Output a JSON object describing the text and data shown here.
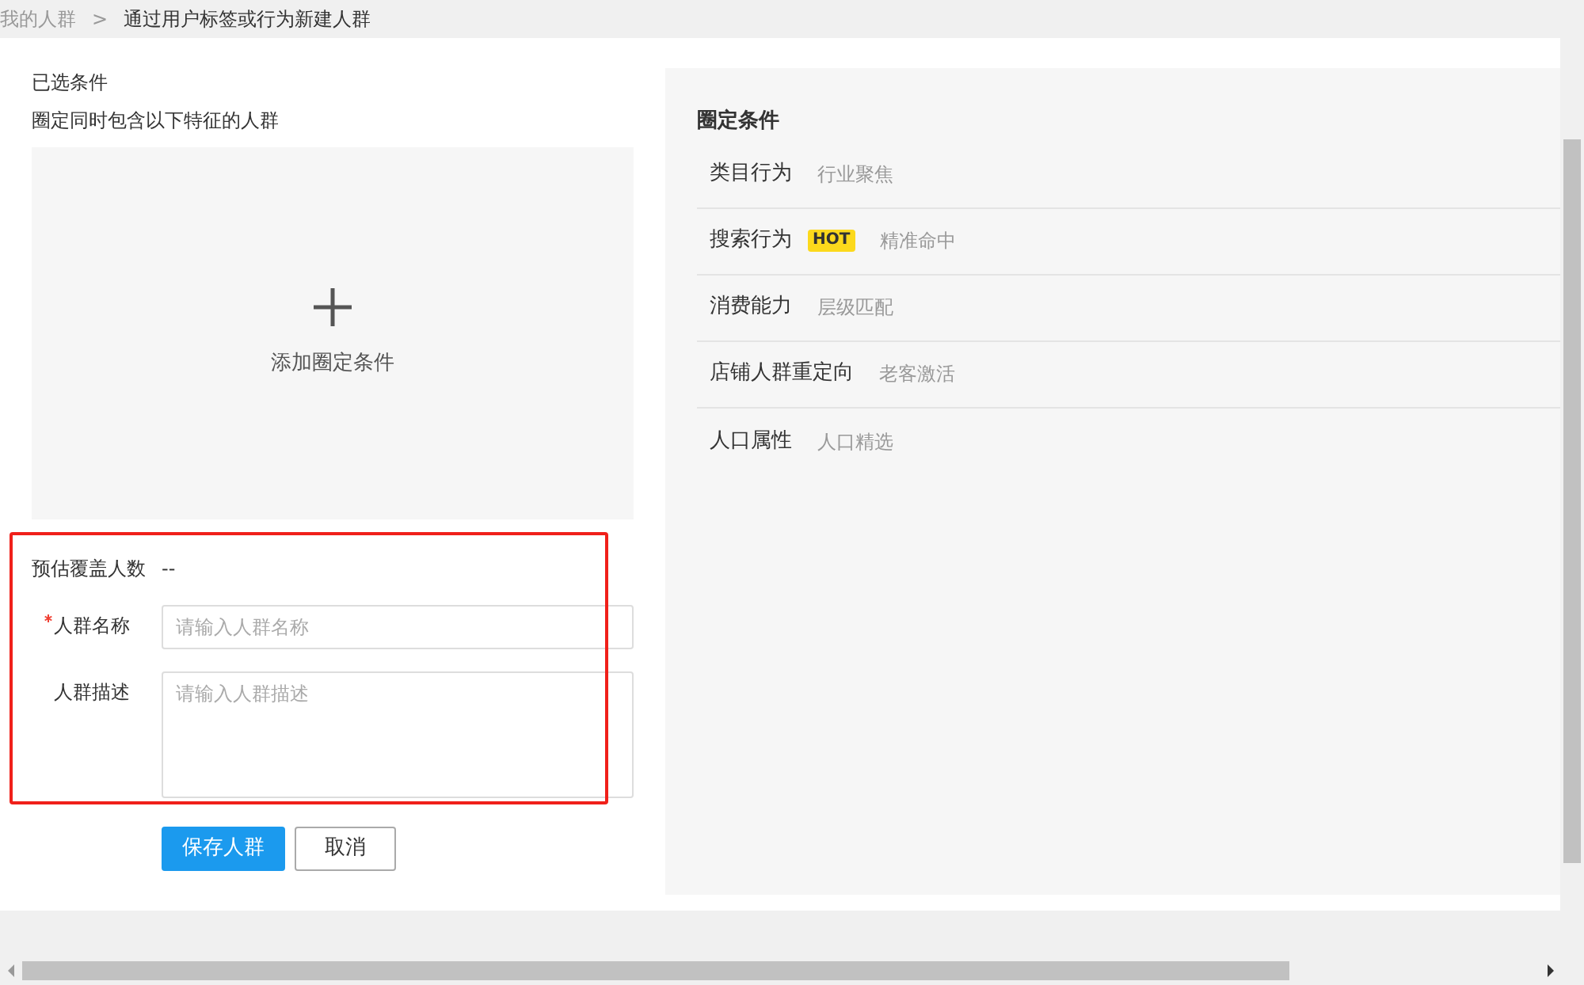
{
  "breadcrumb": {
    "items": [
      "我的人群",
      "通过用户标签或行为新建人群"
    ],
    "separator": ">"
  },
  "selected_conditions": {
    "title": "已选条件",
    "subtitle": "圈定同时包含以下特征的人群",
    "add_label": "添加圈定条件"
  },
  "form": {
    "estimate": {
      "label": "预估覆盖人数",
      "value": "--"
    },
    "fields": [
      {
        "kind": "input",
        "label": "人群名称",
        "required": true,
        "placeholder": "请输入人群名称"
      },
      {
        "kind": "textarea",
        "label": "人群描述",
        "required": false,
        "placeholder": "请输入人群描述"
      }
    ],
    "buttons": [
      {
        "label": "保存人群",
        "primary": true
      },
      {
        "label": "取消",
        "primary": false
      }
    ]
  },
  "conditions_panel": {
    "title": "圈定条件",
    "items": [
      {
        "name": "类目行为",
        "description": "行业聚焦"
      },
      {
        "name": "搜索行为",
        "badge": "HOT",
        "description": "精准命中"
      },
      {
        "name": "消费能力",
        "description": "层级匹配"
      },
      {
        "name": "店铺人群重定向",
        "description": "老客激活"
      },
      {
        "name": "人口属性",
        "description": "人口精选"
      }
    ]
  }
}
